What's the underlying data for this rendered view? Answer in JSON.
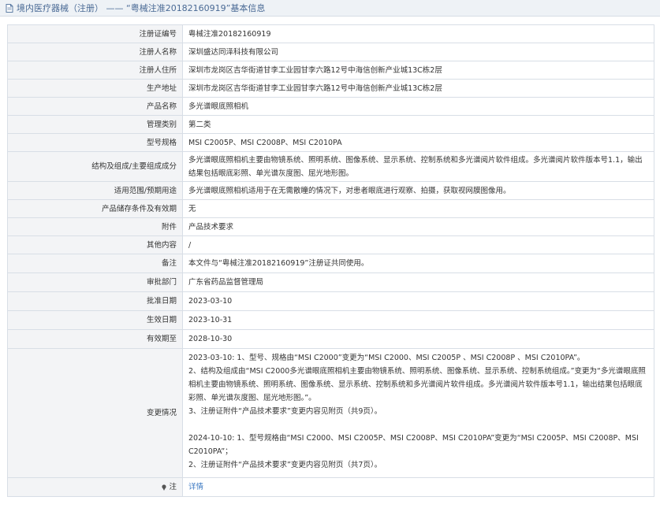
{
  "header": {
    "icon": "document-icon",
    "title": "境内医疗器械（注册） —— “粤械注准20182160919”基本信息"
  },
  "rows": [
    {
      "label": "注册证编号",
      "value": "粤械注准20182160919"
    },
    {
      "label": "注册人名称",
      "value": "深圳盛达同泽科技有限公司"
    },
    {
      "label": "注册人住所",
      "value": "深圳市龙岗区吉华街道甘李工业园甘李六路12号中海信创新产业城13C栋2层"
    },
    {
      "label": "生产地址",
      "value": "深圳市龙岗区吉华街道甘李工业园甘李六路12号中海信创新产业城13C栋2层"
    },
    {
      "label": "产品名称",
      "value": "多光谱眼底照相机"
    },
    {
      "label": "管理类别",
      "value": "第二类"
    },
    {
      "label": "型号规格",
      "value": "MSI C2005P、MSI C2008P、MSI C2010PA"
    },
    {
      "label": "结构及组成/主要组成成分",
      "value": "多光谱眼底照相机主要由物镜系统、照明系统、图像系统、显示系统、控制系统和多光谱阅片软件组成。多光谱阅片软件版本号1.1，输出结果包括眼底彩照、单光谱灰度图、屈光地形图。"
    },
    {
      "label": "适用范围/预期用途",
      "value": "多光谱眼底照相机适用于在无需散瞳的情况下，对患者眼底进行观察、拍摄，获取视网膜图像用。"
    },
    {
      "label": "产品储存条件及有效期",
      "value": "无"
    },
    {
      "label": "附件",
      "value": "产品技术要求"
    },
    {
      "label": "其他内容",
      "value": "/"
    },
    {
      "label": "备注",
      "value": "本文件与“粤械注准20182160919”注册证共同使用。"
    },
    {
      "label": "审批部门",
      "value": "广东省药品监督管理局"
    },
    {
      "label": "批准日期",
      "value": "2023-03-10"
    },
    {
      "label": "生效日期",
      "value": "2023-10-31"
    },
    {
      "label": "有效期至",
      "value": "2028-10-30"
    }
  ],
  "changes": {
    "label": "变更情况",
    "line1": "2023-03-10: 1、型号、规格由“MSI C2000”变更为“MSI C2000、MSI C2005P 、MSI C2008P 、MSI C2010PA”。",
    "line2": "2、结构及组成由“MSI C2000多光谱眼底照相机主要由物镜系统、照明系统、图像系统、显示系统、控制系统组成。”变更为“多光谱眼底照相机主要由物镜系统、照明系统、图像系统、显示系统、控制系统和多光谱阅片软件组成。多光谱阅片软件版本号1.1，输出结果包括眼底彩照、单光谱灰度图、屈光地形图。”。",
    "line3": "3、注册证附件“产品技术要求”变更内容见附页（共9页）。",
    "line4": "2024-10-10: 1、型号规格由“MSI C2000、MSI C2005P、MSI C2008P、MSI C2010PA”变更为“MSI C2005P、MSI C2008P、MSI C2010PA”；",
    "line5": "2、注册证附件“产品技术要求”变更内容见附页（共7页）。"
  },
  "note": {
    "icon": "location-pin-icon",
    "label": "注",
    "link": "详情"
  },
  "colors": {
    "header_bg": "#eef2f6",
    "header_text": "#4a6a95",
    "label_bg": "#f3f4f6",
    "border": "#d8dee6",
    "link": "#3b78c2"
  }
}
